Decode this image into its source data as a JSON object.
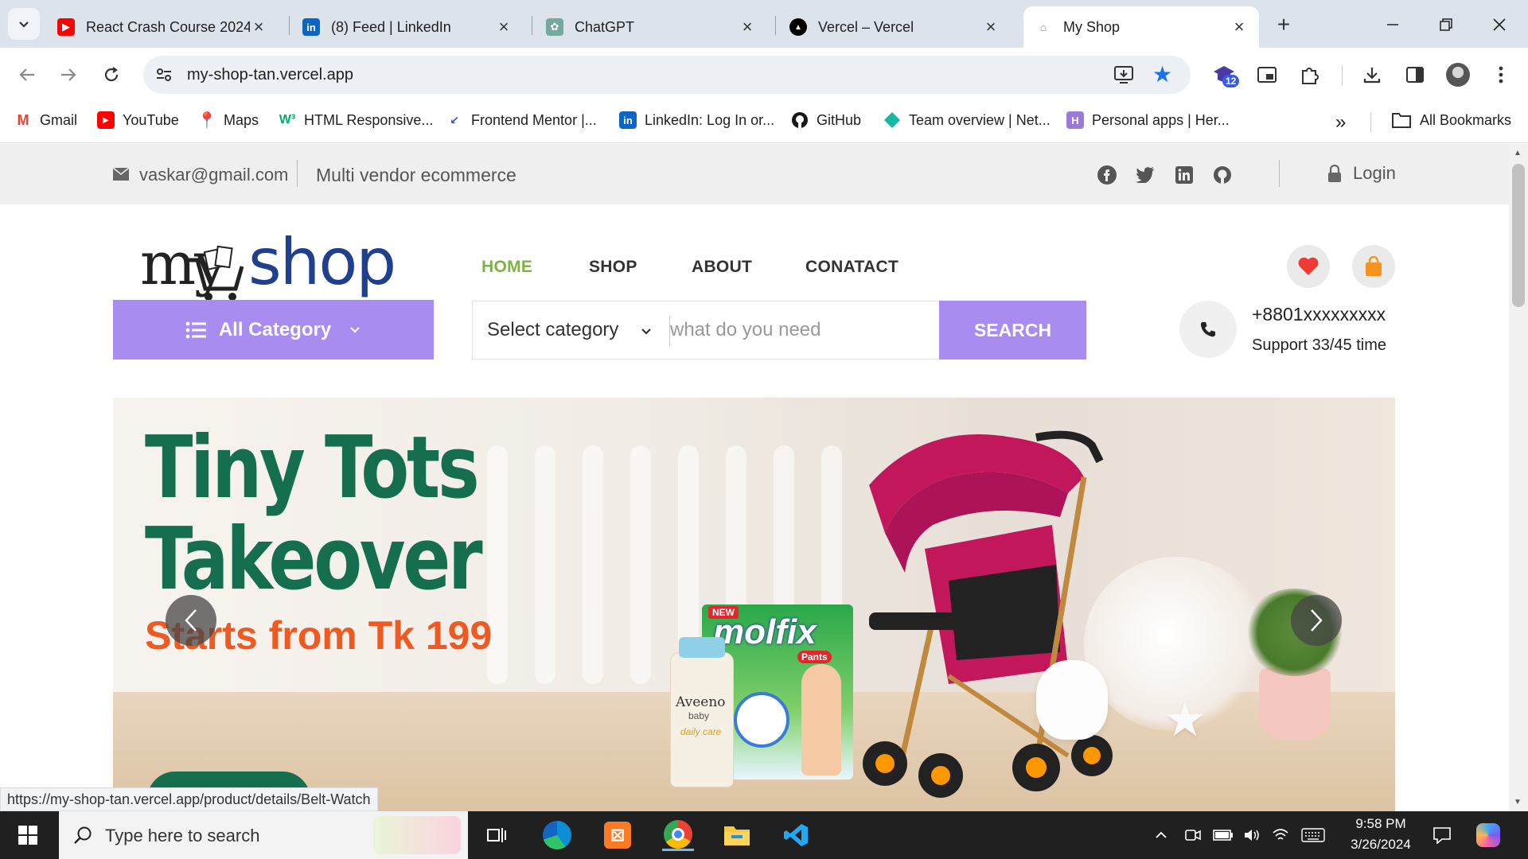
{
  "browser": {
    "tabs": [
      {
        "title": "React Crash Course 2024",
        "icon": "youtube-icon",
        "color": "#ff0000"
      },
      {
        "title": "(8) Feed | LinkedIn",
        "icon": "linkedin-icon",
        "color": "#0a66c2"
      },
      {
        "title": "ChatGPT",
        "icon": "chatgpt-icon",
        "color": "#74aa9c"
      },
      {
        "title": "Vercel – Vercel",
        "icon": "vercel-icon",
        "color": "#000000"
      },
      {
        "title": "My Shop",
        "icon": "myshop-icon",
        "color": "#7a8ca8",
        "active": true
      }
    ],
    "url": "my-shop-tan.vercel.app",
    "extension_badge": "12",
    "bookmarks": [
      {
        "label": "Gmail",
        "icon": "gmail-icon"
      },
      {
        "label": "YouTube",
        "icon": "youtube-icon"
      },
      {
        "label": "Maps",
        "icon": "maps-icon"
      },
      {
        "label": "HTML Responsive...",
        "icon": "w3-icon"
      },
      {
        "label": "Frontend Mentor |...",
        "icon": "frontend-mentor-icon"
      },
      {
        "label": "LinkedIn: Log In or...",
        "icon": "linkedin-icon"
      },
      {
        "label": "GitHub",
        "icon": "github-icon"
      },
      {
        "label": "Team overview | Net...",
        "icon": "netlify-icon"
      },
      {
        "label": "Personal apps | Her...",
        "icon": "heroku-icon"
      }
    ],
    "all_bookmarks": "All Bookmarks",
    "status_url": "https://my-shop-tan.vercel.app/product/details/Belt-Watch"
  },
  "site": {
    "email": "vaskar@gmail.com",
    "tagline": "Multi vendor ecommerce",
    "login": "Login",
    "logo": {
      "part1": "my",
      "part2": "shop"
    },
    "nav": [
      "HOME",
      "SHOP",
      "ABOUT",
      "CONATACT"
    ],
    "all_category": "All Category",
    "select_category": "Select category",
    "search_placeholder": "what do you need",
    "search_button": "SEARCH",
    "phone": "+8801xxxxxxxxx",
    "support": "Support 33/45 time",
    "colors": {
      "accent": "#a88cf0",
      "nav_active": "#7cb342",
      "banner_green": "#156e4e",
      "banner_orange": "#f05a22"
    }
  },
  "banner": {
    "title_line1": "Tiny Tots",
    "title_line2": "Takeover",
    "subtitle": "Starts from Tk 199",
    "product_brand": "molfix",
    "product_tag": "NEW",
    "product_type": "Pants",
    "lotion_brand": "Aveeno",
    "lotion_sub": "baby",
    "lotion_line": "daily care"
  },
  "taskbar": {
    "search_placeholder": "Type here to search",
    "time": "9:58 PM",
    "date": "3/26/2024"
  }
}
